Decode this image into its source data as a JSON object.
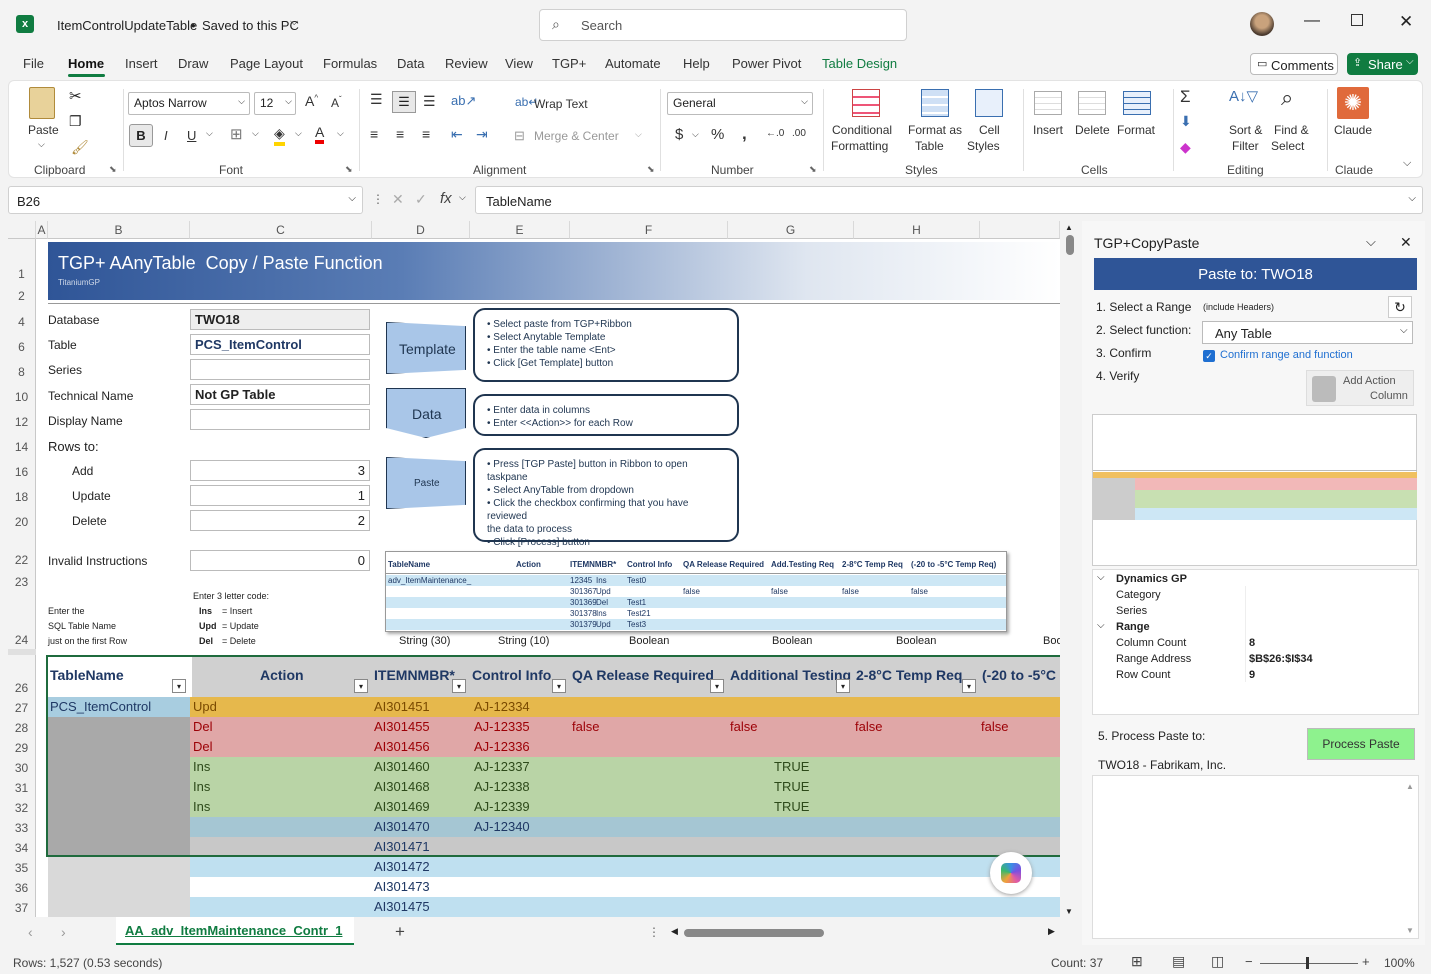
{
  "titlebar": {
    "doc_title": "ItemControlUpdateTable",
    "save_status": "Saved to this PC",
    "search_placeholder": "Search"
  },
  "menu": {
    "tabs": [
      "File",
      "Home",
      "Insert",
      "Draw",
      "Page Layout",
      "Formulas",
      "Data",
      "Review",
      "View",
      "TGP+",
      "Automate",
      "Help",
      "Power Pivot",
      "Table Design"
    ],
    "comments": "Comments",
    "share": "Share"
  },
  "ribbon": {
    "clipboard": {
      "paste": "Paste",
      "label": "Clipboard"
    },
    "font": {
      "name": "Aptos Narrow",
      "size": "12",
      "label": "Font"
    },
    "alignment": {
      "wrap": "Wrap Text",
      "merge": "Merge & Center",
      "label": "Alignment"
    },
    "number": {
      "format": "General",
      "label": "Number"
    },
    "styles": {
      "cond": "Conditional",
      "cond2": "Formatting",
      "fmt_table": "Format as",
      "fmt_table2": "Table",
      "cell_styles": "Cell",
      "cell_styles2": "Styles",
      "label": "Styles"
    },
    "cells": {
      "insert": "Insert",
      "delete": "Delete",
      "format": "Format",
      "label": "Cells"
    },
    "editing": {
      "sort": "Sort &",
      "sort2": "Filter",
      "find": "Find &",
      "find2": "Select",
      "label": "Editing"
    },
    "claude": {
      "name": "Claude",
      "label": "Claude"
    }
  },
  "formula": {
    "namebox": "B26",
    "content": "TableName"
  },
  "columns": [
    "A",
    "B",
    "C",
    "D",
    "E",
    "F",
    "G",
    "H"
  ],
  "sheet": {
    "banner_title": "TGP+ AAnyTable  Copy / Paste Function",
    "banner_sub": "TitaniumGP",
    "labels": {
      "database": "Database",
      "table": "Table",
      "series": "Series",
      "technical": "Technical Name",
      "display": "Display Name",
      "rows_to": "Rows to:",
      "add": "Add",
      "update": "Update",
      "delete": "Delete",
      "invalid": "Invalid Instructions"
    },
    "values": {
      "database": "TWO18",
      "table": "PCS_ItemControl",
      "technical": "Not GP Table",
      "add": "3",
      "update": "1",
      "delete": "2",
      "invalid": "0"
    },
    "code_note": {
      "title": "Enter 3 letter code:",
      "ins": "Ins",
      "ins_desc": "= Insert",
      "upd": "Upd",
      "upd_desc": "= Update",
      "del": "Del",
      "del_desc": "= Delete"
    },
    "enter_note": [
      "Enter the",
      "SQL Table Name",
      "just on the first Row"
    ],
    "steps": {
      "template": "Template",
      "data": "Data",
      "paste": "Paste"
    },
    "bubbles": {
      "template": [
        "• Select paste from TGP+Ribbon",
        "• Select Anytable Template",
        "• Enter the table name <Ent>",
        "• Click [Get Template] button"
      ],
      "data": [
        "• Enter data in columns",
        "• Enter <<Action>> for each Row"
      ],
      "paste": [
        "• Press [TGP Paste] button in Ribbon to open taskpane",
        "• Select AnyTable from dropdown",
        "• Click the checkbox confirming that you have reviewed",
        "the data to process",
        "• Click [Process] button"
      ]
    },
    "type_row": [
      "String (30)",
      "String (10)",
      "Boolean",
      "Boolean",
      "Boolean",
      "Boo"
    ],
    "table_headers": [
      "TableName",
      "Action",
      "ITEMNMBR*",
      "Control Info",
      "QA Release Required",
      "Additional Testing",
      "2-8°C Temp Req",
      "(-20 to -5°C"
    ],
    "preview_headers": [
      "TableName",
      "Action",
      "ITEMNMBR*",
      "Control Info",
      "QA Release Required",
      "Add.Testing Req",
      "2-8°C Temp Req",
      "(-20 to -5°C Temp Req)"
    ],
    "preview_rows": [
      [
        "adv_ItemMaintenance_",
        "Ins",
        "12345",
        "Test0",
        "",
        "",
        "",
        ""
      ],
      [
        "",
        "Upd",
        "301367",
        "",
        "false",
        "false",
        "false",
        "false"
      ],
      [
        "",
        "Del",
        "301369",
        "Test1",
        "",
        "",
        "",
        ""
      ],
      [
        "",
        "Ins",
        "301378",
        "Test21",
        "",
        "",
        "",
        ""
      ],
      [
        "",
        "Upd",
        "301379",
        "Test3",
        "",
        "",
        "",
        ""
      ]
    ],
    "rows": [
      {
        "num": "27",
        "name": "PCS_ItemControl",
        "action": "Upd",
        "item": "AI301451",
        "ctrl": "AJ-12334",
        "qa": "",
        "addl": "",
        "t28": "",
        "t20": ""
      },
      {
        "num": "28",
        "name": "",
        "action": "Del",
        "item": "AI301455",
        "ctrl": "AJ-12335",
        "qa": "false",
        "addl": "false",
        "t28": "false",
        "t20": "false"
      },
      {
        "num": "29",
        "name": "",
        "action": "Del",
        "item": "AI301456",
        "ctrl": "AJ-12336",
        "qa": "",
        "addl": "",
        "t28": "",
        "t20": ""
      },
      {
        "num": "30",
        "name": "",
        "action": "Ins",
        "item": "AI301460",
        "ctrl": "AJ-12337",
        "qa": "",
        "addl": "TRUE",
        "t28": "",
        "t20": ""
      },
      {
        "num": "31",
        "name": "",
        "action": "Ins",
        "item": "AI301468",
        "ctrl": "AJ-12338",
        "qa": "",
        "addl": "TRUE",
        "t28": "",
        "t20": ""
      },
      {
        "num": "32",
        "name": "",
        "action": "Ins",
        "item": "AI301469",
        "ctrl": "AJ-12339",
        "qa": "",
        "addl": "TRUE",
        "t28": "",
        "t20": ""
      },
      {
        "num": "33",
        "name": "",
        "action": "",
        "item": "AI301470",
        "ctrl": "AJ-12340",
        "qa": "",
        "addl": "",
        "t28": "",
        "t20": ""
      },
      {
        "num": "34",
        "name": "",
        "action": "",
        "item": "AI301471",
        "ctrl": "",
        "qa": "",
        "addl": "",
        "t28": "",
        "t20": ""
      },
      {
        "num": "35",
        "name": "",
        "action": "",
        "item": "AI301472",
        "ctrl": "",
        "qa": "",
        "addl": "",
        "t28": "",
        "t20": ""
      },
      {
        "num": "36",
        "name": "",
        "action": "",
        "item": "AI301473",
        "ctrl": "",
        "qa": "",
        "addl": "",
        "t28": "",
        "t20": ""
      },
      {
        "num": "37",
        "name": "",
        "action": "",
        "item": "AI301475",
        "ctrl": "",
        "qa": "",
        "addl": "",
        "t28": "",
        "t20": ""
      }
    ],
    "row_numbers_top": [
      "1",
      "2",
      "4",
      "6",
      "8",
      "10",
      "12",
      "14",
      "16",
      "18",
      "20",
      "22",
      "23",
      "24",
      "26"
    ]
  },
  "sheet_tab": "AA_adv_ItemMaintenance_Contr_1",
  "pane": {
    "title": "TGP+CopyPaste",
    "banner": "Paste to: TWO18",
    "step1": "1. Select a Range",
    "step1_hint": "(include Headers)",
    "step2": "2. Select function:",
    "function_value": "Any Table",
    "step3": "3. Confirm",
    "confirm_label": "Confirm range and function",
    "step4": "4. Verify",
    "add_action": "Add Action",
    "add_action2": "Column",
    "props": {
      "group1": "Dynamics GP",
      "category": "Category",
      "series": "Series",
      "group2": "Range",
      "col_count_label": "Column Count",
      "col_count": "8",
      "range_label": "Range Address",
      "range": "$B$26:$I$34",
      "row_count_label": "Row Count",
      "row_count": "9"
    },
    "step5": "5. Process Paste to:",
    "process_btn": "Process Paste",
    "company": "TWO18 - Fabrikam, Inc."
  },
  "status": {
    "rows": "Rows: 1,527 (0.53 seconds)",
    "count": "Count: 37",
    "zoom": "100%"
  },
  "colors": {
    "excel_green": "#107c41",
    "banner_blue": "#2f5597",
    "upd": "#e6b84c",
    "del": "#e0a7a7",
    "ins": "#b9d4a6",
    "row_blue": "#bfe0f0"
  }
}
